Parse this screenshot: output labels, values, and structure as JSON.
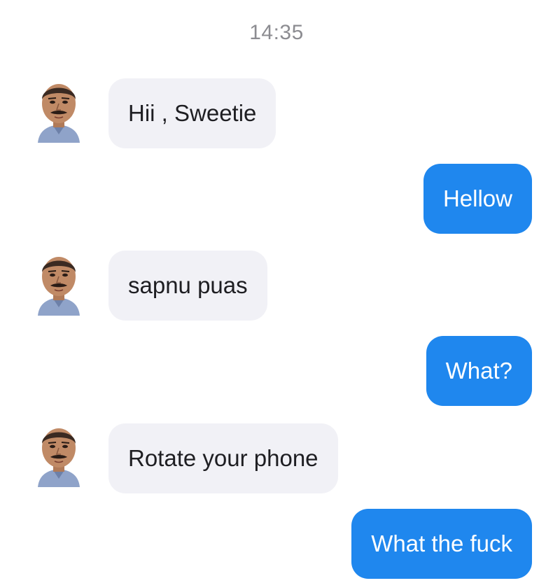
{
  "timestamp": "14:35",
  "messages": [
    {
      "from": "them",
      "text": "Hii , Sweetie"
    },
    {
      "from": "me",
      "text": "Hellow"
    },
    {
      "from": "them",
      "text": "sapnu puas"
    },
    {
      "from": "me",
      "text": "What?"
    },
    {
      "from": "them",
      "text": "Rotate your phone"
    },
    {
      "from": "me",
      "text": "What the fuck"
    }
  ],
  "colors": {
    "incoming_bubble": "#f1f1f6",
    "outgoing_bubble": "#1f87ee",
    "timestamp": "#8c8c91"
  },
  "icons": {
    "avatar": "contact-avatar-icon"
  }
}
